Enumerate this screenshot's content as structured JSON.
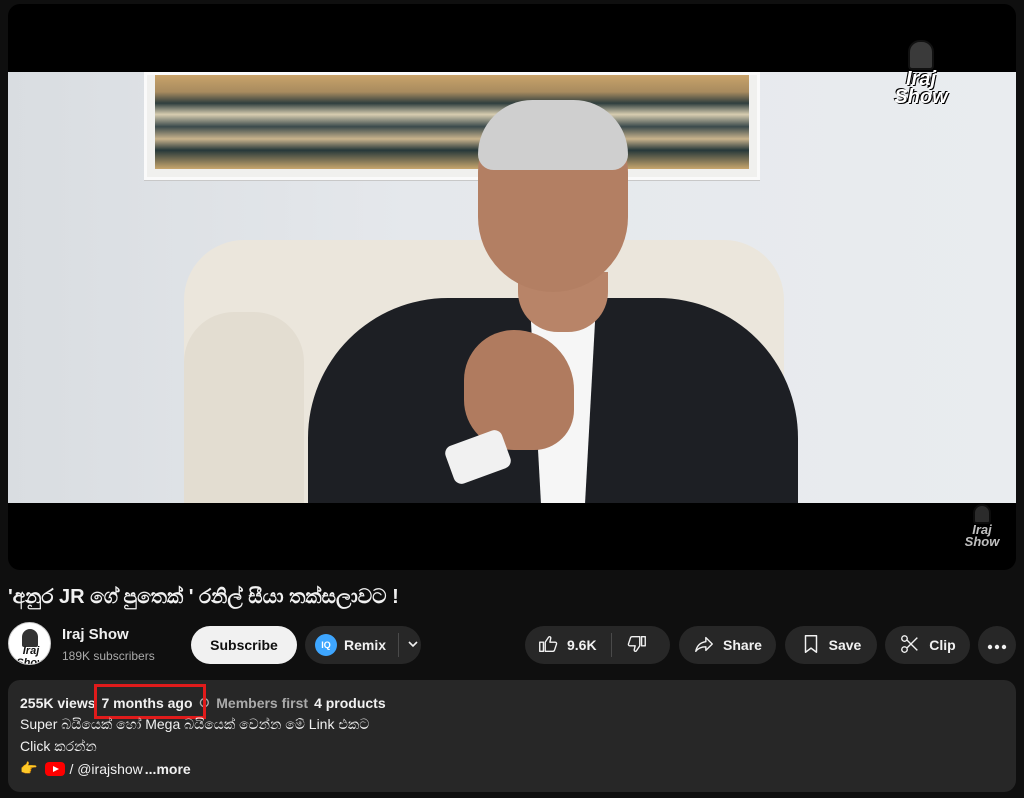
{
  "video": {
    "logo_text": "Iraj Show",
    "watermark_text": "Iraj Show"
  },
  "title": "'අනුර JR ගේ පුතෙක් ' රනිල් සීයා තක්සලාවට !",
  "channel": {
    "name": "Iraj Show",
    "subscribers": "189K subscribers",
    "avatar_text": "Iraj Show"
  },
  "actions": {
    "subscribe_label": "Subscribe",
    "remix_label": "Remix",
    "remix_badge": "IQ",
    "like_count": "9.6K",
    "share_label": "Share",
    "save_label": "Save",
    "clip_label": "Clip"
  },
  "description": {
    "views": "255K views",
    "age": "7 months ago",
    "members_first": "Members first",
    "products": "4 products",
    "line1": "Super බයියෙක් හෝ Mega බයියෙක් වෙන්න මේ Link එකට",
    "line2": "Click කරන්න",
    "line3_prefix": "👉",
    "line3_link": "/ @irajshow",
    "more_label": "...more"
  },
  "colors": {
    "background": "#0f0f0f",
    "surface": "#272727",
    "highlight_box": "#e01b1b",
    "remix_accent": "#3ea6ff"
  }
}
